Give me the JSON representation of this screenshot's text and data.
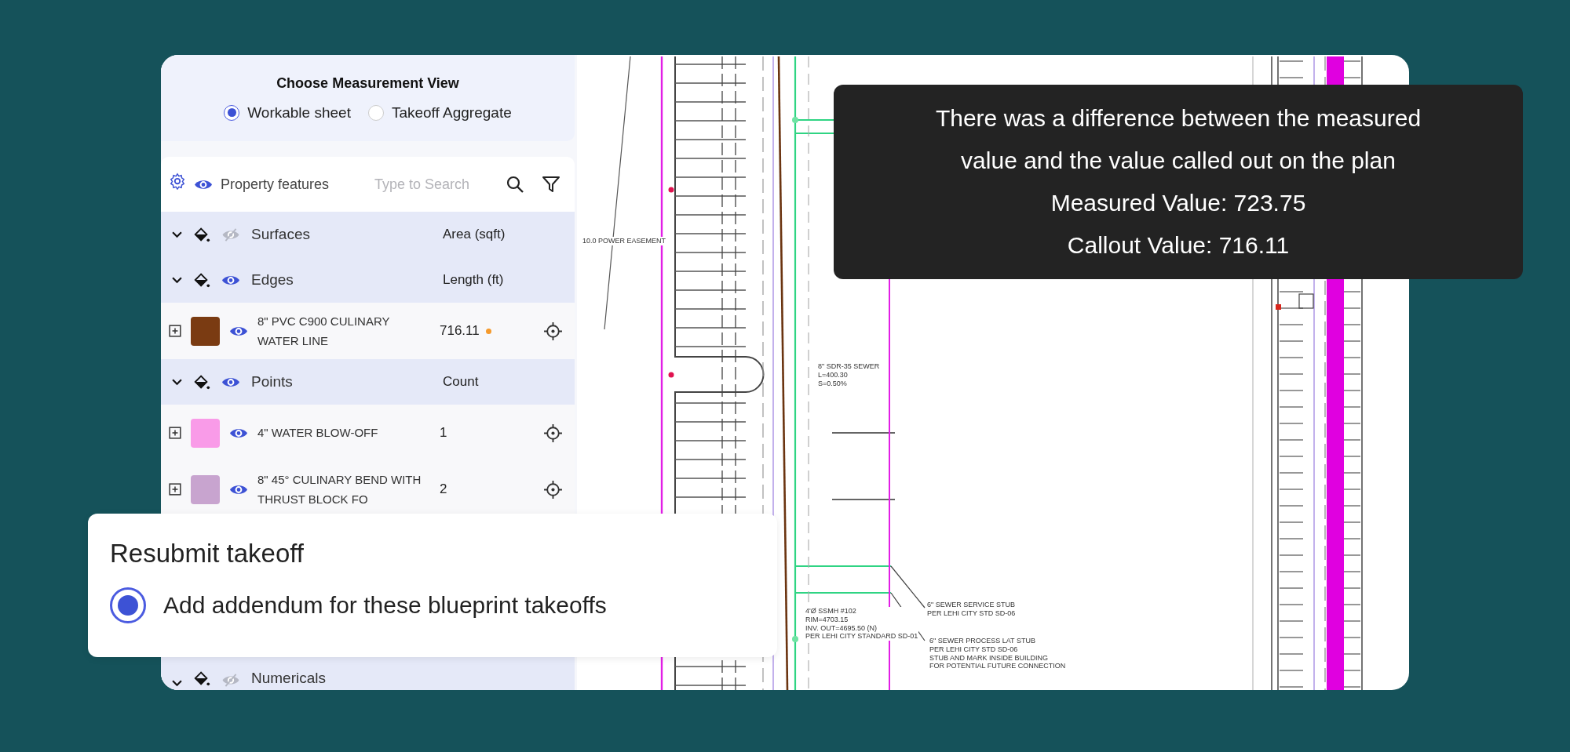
{
  "view_selector": {
    "title": "Choose Measurement View",
    "options": [
      {
        "label": "Workable sheet",
        "selected": true
      },
      {
        "label": "Takeoff Aggregate",
        "selected": false
      }
    ]
  },
  "features": {
    "label": "Property features",
    "search": {
      "placeholder": "Type to Search"
    },
    "groups": [
      {
        "name": "Surfaces",
        "visible": false,
        "column": "Area (sqft)"
      },
      {
        "name": "Edges",
        "visible": true,
        "column": "Length (ft)",
        "items": [
          {
            "name": "8\" PVC C900 CULINARY WATER LINE",
            "color": "#7a3b12",
            "visible": true,
            "value": "716.11",
            "flagged": true
          }
        ]
      },
      {
        "name": "Points",
        "visible": true,
        "column": "Count",
        "items": [
          {
            "name": "4\" WATER BLOW-OFF",
            "color": "#f99be8",
            "visible": true,
            "value": "1",
            "flagged": false
          },
          {
            "name": "8\" 45° CULINARY BEND WITH THRUST BLOCK FO",
            "color": "#c8a4cf",
            "visible": true,
            "value": "2",
            "flagged": false
          }
        ]
      },
      {
        "name": "Numericals",
        "visible": false
      }
    ]
  },
  "plan_labels": [
    {
      "text": "10.0 POWER EASEMENT"
    },
    {
      "text": "8\" SDR-35 SEWER\nL=400.30\nS=0.50%"
    },
    {
      "text": "4'Ø SSMH #102\nRIM=4703.15\nINV. OUT=4695.50 (N)\nPER LEHI CITY STANDARD SD-01"
    },
    {
      "text": "6\" SEWER SERVICE STUB\nPER LEHI CITY STD SD-06"
    },
    {
      "text": "6\" SEWER PROCESS LAT STUB\nPER LEHI CITY STD SD-06\nSTUB AND MARK INSIDE BUILDING\nFOR POTENTIAL FUTURE CONNECTION"
    }
  ],
  "tooltip": {
    "message": "There was a difference between the measured value and the value called out on the plan",
    "lines": [
      "Measured Value: 723.75",
      "Callout Value: 716.11"
    ]
  },
  "resubmit": {
    "title": "Resubmit takeoff",
    "option": {
      "label": "Add addendum for these blueprint takeoffs",
      "selected": true
    }
  }
}
